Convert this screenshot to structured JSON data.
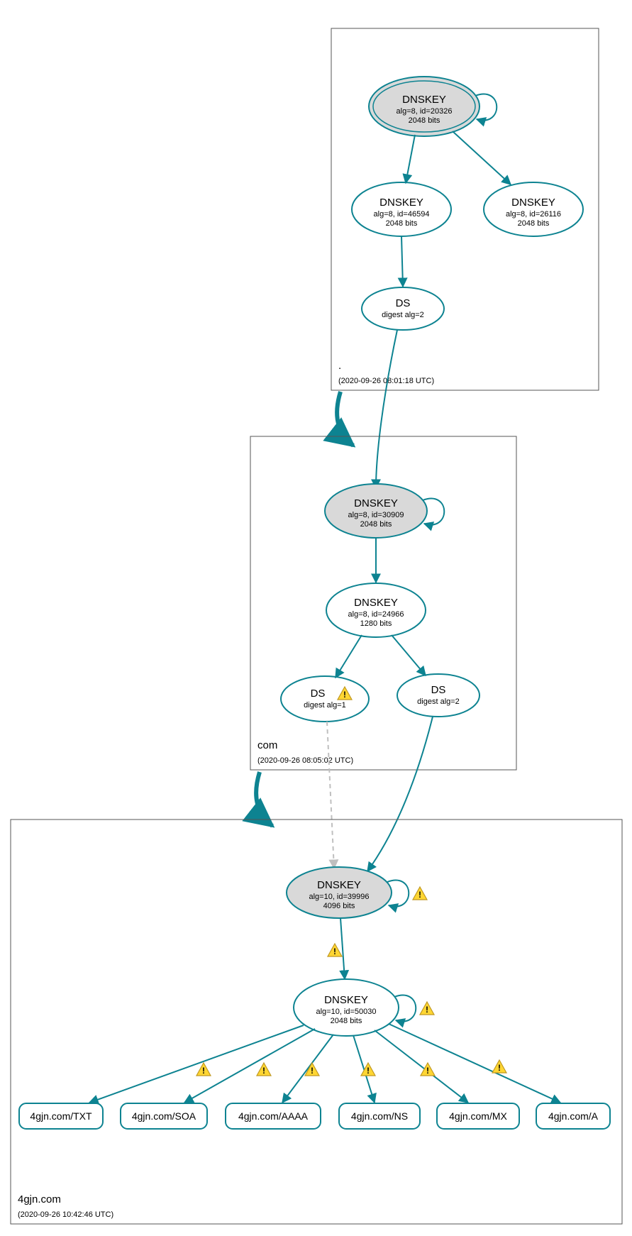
{
  "colors": {
    "teal": "#0d8391",
    "nodeFill": "#d9d9d9",
    "boxStroke": "#555555",
    "dashedGrey": "#bfbfbf",
    "warnFill": "#ffd633",
    "warnStroke": "#c09820"
  },
  "zones": {
    "root": {
      "name": ".",
      "timestamp": "(2020-09-26 08:01:18 UTC)"
    },
    "com": {
      "name": "com",
      "timestamp": "(2020-09-26 08:05:02 UTC)"
    },
    "leaf": {
      "name": "4gjn.com",
      "timestamp": "(2020-09-26 10:42:46 UTC)"
    }
  },
  "nodes": {
    "root_ksk": {
      "title": "DNSKEY",
      "line1": "alg=8, id=20326",
      "line2": "2048 bits"
    },
    "root_zsk1": {
      "title": "DNSKEY",
      "line1": "alg=8, id=46594",
      "line2": "2048 bits"
    },
    "root_zsk2": {
      "title": "DNSKEY",
      "line1": "alg=8, id=26116",
      "line2": "2048 bits"
    },
    "root_ds": {
      "title": "DS",
      "line1": "digest alg=2"
    },
    "com_ksk": {
      "title": "DNSKEY",
      "line1": "alg=8, id=30909",
      "line2": "2048 bits"
    },
    "com_zsk": {
      "title": "DNSKEY",
      "line1": "alg=8, id=24966",
      "line2": "1280 bits"
    },
    "com_ds1": {
      "title": "DS",
      "line1": "digest alg=1"
    },
    "com_ds2": {
      "title": "DS",
      "line1": "digest alg=2"
    },
    "leaf_ksk": {
      "title": "DNSKEY",
      "line1": "alg=10, id=39996",
      "line2": "4096 bits"
    },
    "leaf_zsk": {
      "title": "DNSKEY",
      "line1": "alg=10, id=50030",
      "line2": "2048 bits"
    }
  },
  "rrsets": {
    "txt": "4gjn.com/TXT",
    "soa": "4gjn.com/SOA",
    "aaaa": "4gjn.com/AAAA",
    "ns": "4gjn.com/NS",
    "mx": "4gjn.com/MX",
    "a": "4gjn.com/A"
  }
}
